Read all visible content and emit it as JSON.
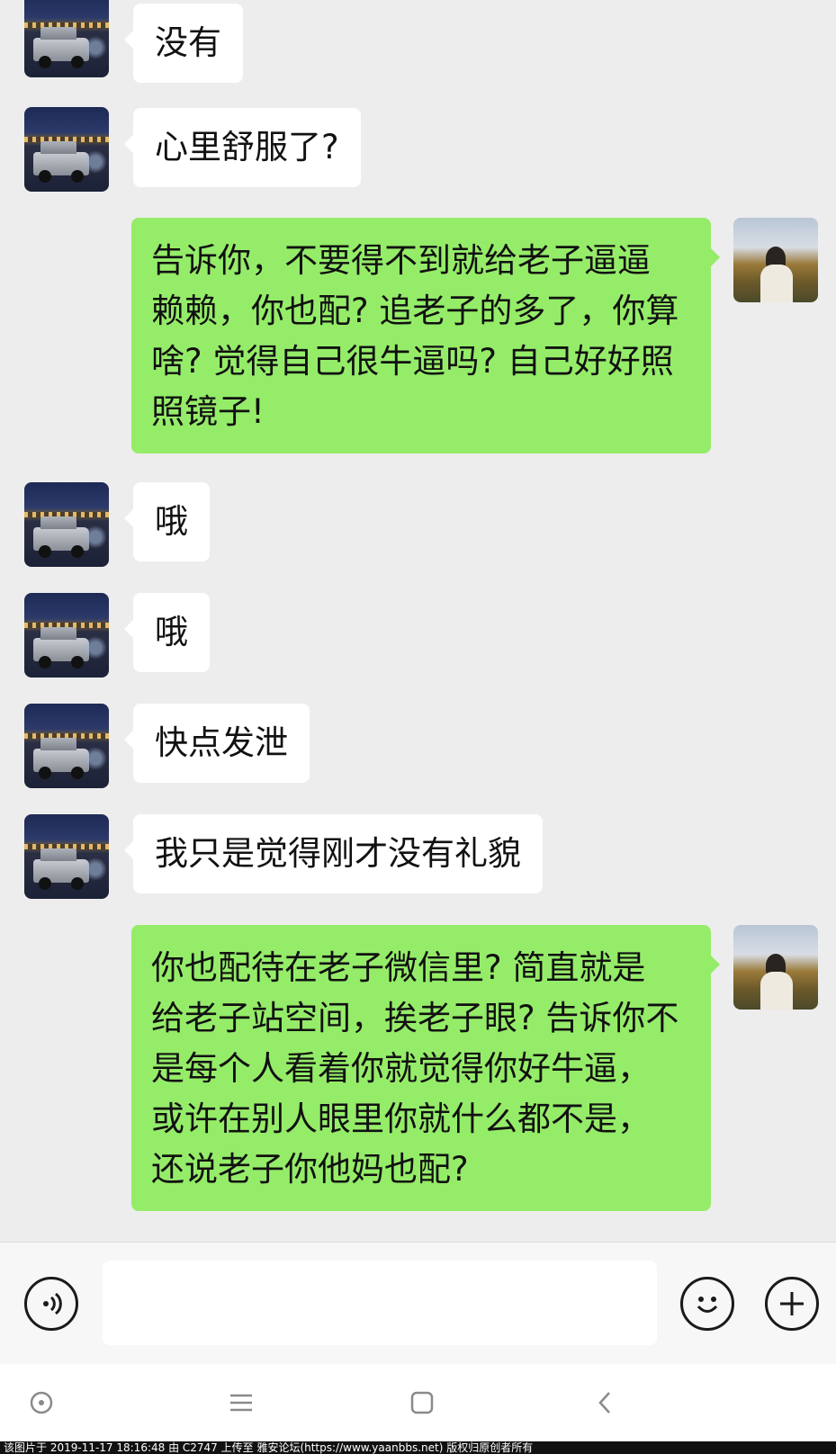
{
  "messages": [
    {
      "side": "left",
      "text": "没有"
    },
    {
      "side": "left",
      "text": "心里舒服了?"
    },
    {
      "side": "right",
      "lines": [
        "告诉你，不要得不到就给老子逼逼",
        "赖赖，你也配? 追老子的多了，你算",
        "啥? 觉得自己很牛逼吗? 自己好好照",
        "照镜子!"
      ]
    },
    {
      "side": "left",
      "text": "哦"
    },
    {
      "side": "left",
      "text": "哦"
    },
    {
      "side": "left",
      "text": "快点发泄"
    },
    {
      "side": "left",
      "text": "我只是觉得刚才没有礼貌"
    },
    {
      "side": "right",
      "lines": [
        "你也配待在老子微信里? 简直就是",
        "给老子站空间，挨老子眼? 告诉你不",
        "是每个人看着你就觉得你好牛逼，",
        "或许在别人眼里你就什么都不是，",
        "还说老子你他妈也配?"
      ]
    }
  ],
  "input": {
    "placeholder": ""
  },
  "icons": {
    "voice": "voice-icon",
    "emoji": "emoji-icon",
    "plus": "plus-icon",
    "nav_home": "circle-dot-icon",
    "nav_menu": "menu-icon",
    "nav_square": "square-icon",
    "nav_back": "back-arrow-icon"
  },
  "colors": {
    "sent_bubble": "#95ec69",
    "received_bubble": "#ffffff",
    "background": "#ededed"
  },
  "watermark": "该图片于 2019-11-17 18:16:48 由 C2747 上传至 雅安论坛(https://www.yaanbbs.net) 版权归原创者所有"
}
